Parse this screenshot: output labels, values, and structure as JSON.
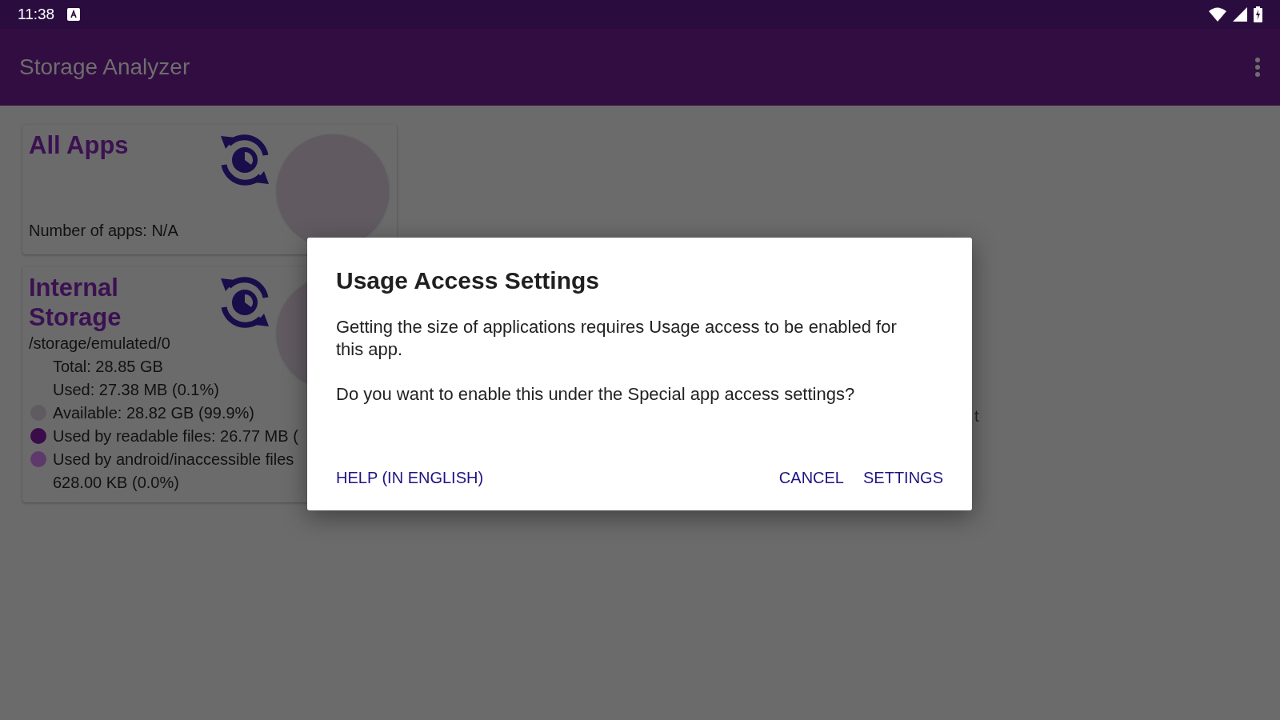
{
  "status_bar": {
    "time": "11:38"
  },
  "app_bar": {
    "title": "Storage Analyzer"
  },
  "cards": [
    {
      "title": "All Apps",
      "lines": [
        {
          "text": "Number of apps: N/A",
          "kind": "plain"
        }
      ]
    },
    {
      "title": "Internal Storage",
      "subtitle": "/storage/emulated/0",
      "lines": [
        {
          "text": "Total: 28.85 GB",
          "kind": "plain"
        },
        {
          "text": "Used: 27.38 MB (0.1%)",
          "kind": "plain"
        },
        {
          "text": "Available: 28.82 GB (99.9%)",
          "kind": "legend",
          "color": "#605b61"
        },
        {
          "text": "Used by readable files: 26.77 MB (",
          "kind": "legend",
          "color": "#3a0c4a"
        },
        {
          "text": "Used by android/inaccessible files\n628.00 KB (0.0%)",
          "kind": "legend",
          "color": "#5d3a6b"
        }
      ]
    }
  ],
  "background_fragment": "t",
  "dialog": {
    "title": "Usage Access Settings",
    "paragraphs": [
      "Getting the size of applications requires Usage access to be enabled for this app.",
      "Do you want to enable this under the Special app access settings?"
    ],
    "buttons": [
      {
        "label": "HELP (IN ENGLISH)",
        "kind": "neutral"
      },
      {
        "label": "CANCEL",
        "kind": "action"
      },
      {
        "label": "SETTINGS",
        "kind": "action"
      }
    ]
  }
}
